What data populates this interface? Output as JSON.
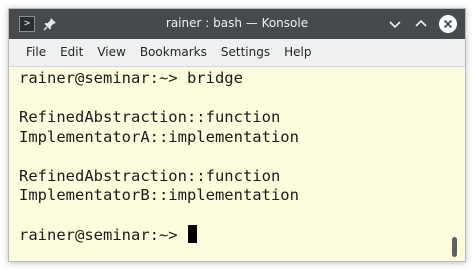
{
  "window": {
    "title": "rainer : bash — Konsole",
    "accent_titlebar": "#474a4d",
    "terminal_bg": "#fdfcdc"
  },
  "titlebar_icons": {
    "app": "terminal-icon",
    "pin": "pin-icon",
    "buttons": [
      "minimize-chevron-down-icon",
      "maximize-chevron-up-icon",
      "close-icon"
    ]
  },
  "menubar": {
    "items": [
      "File",
      "Edit",
      "View",
      "Bookmarks",
      "Settings",
      "Help"
    ]
  },
  "terminal": {
    "lines": [
      "rainer@seminar:~> bridge",
      "",
      "RefinedAbstraction::function",
      "ImplementatorA::implementation",
      "",
      "RefinedAbstraction::function",
      "ImplementatorB::implementation",
      "",
      "rainer@seminar:~> "
    ]
  }
}
